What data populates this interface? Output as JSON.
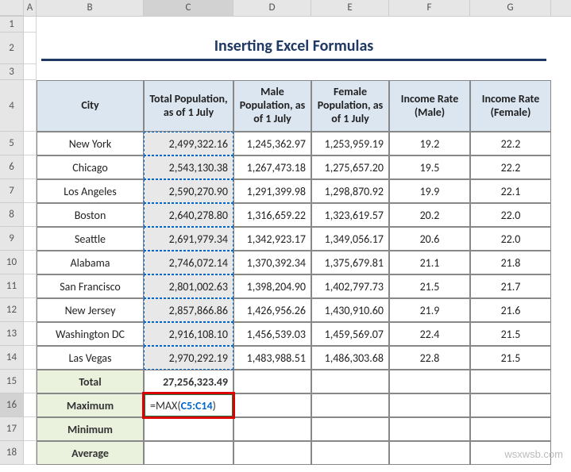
{
  "columns": [
    "A",
    "B",
    "C",
    "D",
    "E",
    "F",
    "G"
  ],
  "title": "Inserting Excel Formulas",
  "headers": {
    "city": "City",
    "totalPop": "Total Population, as of 1 July",
    "malePop": "Male Population, as of 1 July",
    "femalePop": "Female Population, as of 1 July",
    "incomeMale": "Income Rate (Male)",
    "incomeFemale": "Income Rate (Female)"
  },
  "rows": [
    {
      "city": "New York",
      "total": "2,499,322.16",
      "male": "1,245,362.97",
      "female": "1,253,959.19",
      "im": "19.2",
      "if": "22.2"
    },
    {
      "city": "Chicago",
      "total": "2,543,130.38",
      "male": "1,267,473.18",
      "female": "1,275,657.20",
      "im": "19.5",
      "if": "22.2"
    },
    {
      "city": "Los Angeles",
      "total": "2,590,270.90",
      "male": "1,291,399.98",
      "female": "1,298,870.92",
      "im": "19.9",
      "if": "22.1"
    },
    {
      "city": "Boston",
      "total": "2,640,278.80",
      "male": "1,316,659.22",
      "female": "1,323,619.57",
      "im": "20.2",
      "if": "22.0"
    },
    {
      "city": "Seattle",
      "total": "2,691,979.34",
      "male": "1,342,923.17",
      "female": "1,349,056.17",
      "im": "20.6",
      "if": "22.0"
    },
    {
      "city": "Alabama",
      "total": "2,746,072.14",
      "male": "1,370,392.34",
      "female": "1,375,679.81",
      "im": "21.1",
      "if": "21.8"
    },
    {
      "city": "San Francisco",
      "total": "2,801,002.63",
      "male": "1,398,204.90",
      "female": "1,402,797.73",
      "im": "21.5",
      "if": "21.7"
    },
    {
      "city": "New Jersey",
      "total": "2,857,866.86",
      "male": "1,426,956.26",
      "female": "1,430,910.60",
      "im": "21.9",
      "if": "21.6"
    },
    {
      "city": "Washington DC",
      "total": "2,916,108.10",
      "male": "1,456,539.03",
      "female": "1,459,569.07",
      "im": "22.4",
      "if": "21.5"
    },
    {
      "city": "Las Vegas",
      "total": "2,970,292.19",
      "male": "1,483,988.51",
      "female": "1,486,303.68",
      "im": "22.8",
      "if": "21.5"
    }
  ],
  "summary": {
    "total_label": "Total",
    "total_val": "27,256,323.49",
    "max_label": "Maximum",
    "min_label": "Minimum",
    "avg_label": "Average"
  },
  "formula": {
    "eq": "=",
    "fn": "MAX",
    "open": "(",
    "ref": "C5:C14",
    "close": ")"
  },
  "activeCol": "C",
  "watermark": "wsxwsb.com",
  "chart_data": {
    "type": "table",
    "title": "Inserting Excel Formulas",
    "columns": [
      "City",
      "Total Population, as of 1 July",
      "Male Population, as of 1 July",
      "Female Population, as of 1 July",
      "Income Rate (Male)",
      "Income Rate (Female)"
    ],
    "data": [
      [
        "New York",
        2499322.16,
        1245362.97,
        1253959.19,
        19.2,
        22.2
      ],
      [
        "Chicago",
        2543130.38,
        1267473.18,
        1275657.2,
        19.5,
        22.2
      ],
      [
        "Los Angeles",
        2590270.9,
        1291399.98,
        1298870.92,
        19.9,
        22.1
      ],
      [
        "Boston",
        2640278.8,
        1316659.22,
        1323619.57,
        20.2,
        22.0
      ],
      [
        "Seattle",
        2691979.34,
        1342923.17,
        1349056.17,
        20.6,
        22.0
      ],
      [
        "Alabama",
        2746072.14,
        1370392.34,
        1375679.81,
        21.1,
        21.8
      ],
      [
        "San Francisco",
        2801002.63,
        1398204.9,
        1402797.73,
        21.5,
        21.7
      ],
      [
        "New Jersey",
        2857866.86,
        1426956.26,
        1430910.6,
        21.9,
        21.6
      ],
      [
        "Washington DC",
        2916108.1,
        1456539.03,
        1459569.07,
        22.4,
        21.5
      ],
      [
        "Las Vegas",
        2970292.19,
        1483988.51,
        1486303.68,
        22.8,
        21.5
      ]
    ],
    "totals": {
      "Total Population": 27256323.49
    },
    "active_formula": "=MAX(C5:C14)"
  }
}
